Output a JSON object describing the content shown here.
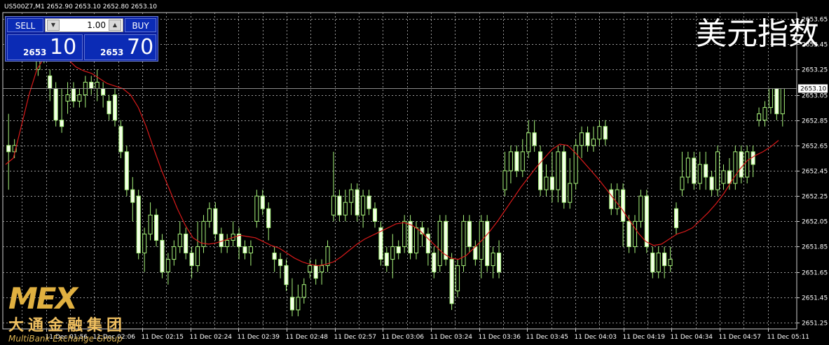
{
  "header": {
    "title": "US500Z7,M1  2652.90 2653.10 2652.80 2653.10",
    "watermark": "美元指数"
  },
  "trade_panel": {
    "sell_label": "SELL",
    "buy_label": "BUY",
    "lot": "1.00",
    "sell_small": "2653",
    "sell_big": "10",
    "buy_small": "2653",
    "buy_big": "70"
  },
  "logo": {
    "mark": "MEX",
    "cn": "大通金融集团",
    "en": "MultiBank Exchange Group"
  },
  "colors": {
    "background": "#000000",
    "grid": "#9a9a9a",
    "candle": "#a6f27a",
    "ma": "#d81a1a",
    "current_price_line": "#8a8a8a"
  },
  "chart_data": {
    "type": "line",
    "ylim": [
      2651.2,
      2653.7
    ],
    "current_price": "2653.10",
    "y_ticks": [
      "2653.65",
      "2653.45",
      "2653.25",
      "2653.05",
      "2652.85",
      "2652.65",
      "2652.45",
      "2652.25",
      "2652.05",
      "2651.85",
      "2651.65",
      "2651.45",
      "2651.25"
    ],
    "x_ticks": [
      "11 Dec 01:56",
      "11 Dec 02:06",
      "11 Dec 02:15",
      "11 Dec 02:24",
      "11 Dec 02:39",
      "11 Dec 02:48",
      "11 Dec 02:57",
      "11 Dec 03:06",
      "11 Dec 03:24",
      "11 Dec 03:36",
      "11 Dec 03:45",
      "11 Dec 04:03",
      "11 Dec 04:19",
      "11 Dec 04:34",
      "11 Dec 04:57",
      "11 Dec 05:11"
    ],
    "candles": [
      [
        2652.65,
        2652.6,
        2652.9,
        2652.3
      ],
      [
        2652.6,
        2652.65,
        2652.7,
        2652.55
      ],
      [
        2653.45,
        2653.5,
        2653.6,
        2653.35
      ],
      [
        2653.55,
        2653.5,
        2653.6,
        2653.45
      ],
      [
        2653.4,
        2653.55,
        2653.6,
        2653.35
      ],
      [
        2653.25,
        2653.4,
        2653.45,
        2653.2
      ],
      [
        2653.4,
        2653.5,
        2653.55,
        2653.3
      ],
      [
        2653.2,
        2653.1,
        2653.25,
        2653.0
      ],
      [
        2653.1,
        2652.85,
        2653.15,
        2652.8
      ],
      [
        2652.85,
        2652.8,
        2653.1,
        2652.75
      ],
      [
        2653.0,
        2653.05,
        2653.15,
        2652.9
      ],
      [
        2653.1,
        2653.0,
        2653.15,
        2652.95
      ],
      [
        2653.0,
        2653.05,
        2653.1,
        2652.95
      ],
      [
        2653.05,
        2653.15,
        2653.2,
        2652.95
      ],
      [
        2653.15,
        2653.1,
        2653.2,
        2653.05
      ],
      [
        2653.1,
        2653.15,
        2653.25,
        2653.0
      ],
      [
        2653.1,
        2653.05,
        2653.15,
        2652.95
      ],
      [
        2653.0,
        2652.9,
        2653.05,
        2652.85
      ],
      [
        2653.05,
        2652.85,
        2653.1,
        2652.8
      ],
      [
        2652.8,
        2652.6,
        2652.85,
        2652.55
      ],
      [
        2652.6,
        2652.3,
        2652.65,
        2652.25
      ],
      [
        2652.3,
        2652.2,
        2652.4,
        2652.05
      ],
      [
        2652.25,
        2651.8,
        2652.3,
        2651.75
      ],
      [
        2651.8,
        2651.95,
        2652.0,
        2651.65
      ],
      [
        2651.95,
        2652.1,
        2652.2,
        2651.9
      ],
      [
        2652.1,
        2651.9,
        2652.15,
        2651.85
      ],
      [
        2651.9,
        2651.65,
        2651.95,
        2651.6
      ],
      [
        2651.65,
        2651.75,
        2651.8,
        2651.55
      ],
      [
        2651.75,
        2651.85,
        2651.9,
        2651.7
      ],
      [
        2651.85,
        2651.95,
        2652.05,
        2651.8
      ],
      [
        2651.95,
        2651.8,
        2652.0,
        2651.75
      ],
      [
        2651.8,
        2651.7,
        2651.85,
        2651.6
      ],
      [
        2651.7,
        2651.85,
        2652.05,
        2651.65
      ],
      [
        2651.85,
        2652.05,
        2652.1,
        2651.8
      ],
      [
        2652.05,
        2652.15,
        2652.2,
        2652.0
      ],
      [
        2652.15,
        2651.95,
        2652.2,
        2651.9
      ],
      [
        2651.95,
        2651.85,
        2652.0,
        2651.8
      ],
      [
        2651.85,
        2651.9,
        2651.95,
        2651.8
      ],
      [
        2651.9,
        2651.95,
        2652.05,
        2651.85
      ],
      [
        2651.95,
        2651.85,
        2652.0,
        2651.75
      ],
      [
        2651.85,
        2651.8,
        2651.9,
        2651.75
      ],
      [
        2651.8,
        2651.85,
        2651.9,
        2651.7
      ],
      [
        2652.05,
        2652.25,
        2652.3,
        2652.0
      ],
      [
        2652.25,
        2652.15,
        2652.3,
        2652.1
      ],
      [
        2652.15,
        2652.0,
        2652.2,
        2651.9
      ],
      [
        2651.8,
        2651.75,
        2651.85,
        2651.65
      ],
      [
        2651.75,
        2651.7,
        2651.8,
        2651.6
      ],
      [
        2651.7,
        2651.55,
        2651.75,
        2651.5
      ],
      [
        2651.45,
        2651.35,
        2651.6,
        2651.3
      ],
      [
        2651.35,
        2651.45,
        2651.55,
        2651.3
      ],
      [
        2651.45,
        2651.55,
        2651.6,
        2651.4
      ],
      [
        2651.65,
        2651.7,
        2651.75,
        2651.6
      ],
      [
        2651.7,
        2651.6,
        2651.75,
        2651.55
      ],
      [
        2651.65,
        2651.7,
        2651.75,
        2651.55
      ],
      [
        2651.7,
        2651.85,
        2651.9,
        2651.65
      ],
      [
        2652.1,
        2652.25,
        2652.6,
        2652.05
      ],
      [
        2652.25,
        2652.1,
        2652.3,
        2652.05
      ],
      [
        2652.1,
        2652.2,
        2652.3,
        2652.05
      ],
      [
        2652.2,
        2652.3,
        2652.35,
        2652.1
      ],
      [
        2652.3,
        2652.1,
        2652.35,
        2652.05
      ],
      [
        2652.1,
        2652.25,
        2652.3,
        2652.0
      ],
      [
        2652.25,
        2652.15,
        2652.3,
        2652.1
      ],
      [
        2652.15,
        2652.05,
        2652.2,
        2652.0
      ],
      [
        2652.0,
        2651.75,
        2652.05,
        2651.7
      ],
      [
        2651.8,
        2651.7,
        2651.85,
        2651.65
      ],
      [
        2651.75,
        2651.85,
        2651.95,
        2651.6
      ],
      [
        2651.85,
        2651.8,
        2651.9,
        2651.75
      ],
      [
        2651.85,
        2652.05,
        2652.1,
        2651.8
      ],
      [
        2652.05,
        2651.8,
        2652.1,
        2651.75
      ],
      [
        2651.8,
        2652.0,
        2652.05,
        2651.75
      ],
      [
        2652.0,
        2651.95,
        2652.05,
        2651.85
      ],
      [
        2651.95,
        2651.8,
        2652.0,
        2651.7
      ],
      [
        2651.8,
        2651.65,
        2651.85,
        2651.6
      ],
      [
        2651.7,
        2652.05,
        2652.1,
        2651.65
      ],
      [
        2652.05,
        2651.75,
        2652.1,
        2651.7
      ],
      [
        2651.75,
        2651.4,
        2651.8,
        2651.35
      ],
      [
        2651.5,
        2651.7,
        2651.75,
        2651.45
      ],
      [
        2651.7,
        2652.05,
        2652.1,
        2651.65
      ],
      [
        2652.05,
        2651.85,
        2652.1,
        2651.8
      ],
      [
        2651.85,
        2651.75,
        2651.9,
        2651.7
      ],
      [
        2651.75,
        2652.05,
        2652.1,
        2651.6
      ],
      [
        2652.05,
        2651.7,
        2652.1,
        2651.65
      ],
      [
        2651.7,
        2651.8,
        2651.85,
        2651.6
      ],
      [
        2651.8,
        2651.65,
        2651.9,
        2651.6
      ],
      [
        2652.3,
        2652.45,
        2652.6,
        2652.25
      ],
      [
        2652.45,
        2652.6,
        2652.65,
        2652.35
      ],
      [
        2652.6,
        2652.45,
        2652.65,
        2652.4
      ],
      [
        2652.45,
        2652.6,
        2652.7,
        2652.4
      ],
      [
        2652.6,
        2652.75,
        2652.85,
        2652.55
      ],
      [
        2652.75,
        2652.65,
        2652.85,
        2652.6
      ],
      [
        2652.6,
        2652.3,
        2652.65,
        2652.25
      ],
      [
        2652.3,
        2652.4,
        2652.5,
        2652.25
      ],
      [
        2652.4,
        2652.3,
        2652.6,
        2652.2
      ],
      [
        2652.3,
        2652.6,
        2652.65,
        2652.2
      ],
      [
        2652.6,
        2652.2,
        2652.65,
        2652.15
      ],
      [
        2652.2,
        2652.35,
        2652.55,
        2652.15
      ],
      [
        2652.35,
        2652.65,
        2652.7,
        2652.3
      ],
      [
        2652.65,
        2652.75,
        2652.8,
        2652.55
      ],
      [
        2652.75,
        2652.65,
        2652.8,
        2652.6
      ],
      [
        2652.65,
        2652.7,
        2652.8,
        2652.6
      ],
      [
        2652.7,
        2652.8,
        2652.85,
        2652.65
      ],
      [
        2652.8,
        2652.7,
        2652.85,
        2652.65
      ],
      [
        2652.3,
        2652.15,
        2652.35,
        2652.1
      ],
      [
        2652.15,
        2652.3,
        2652.35,
        2652.1
      ],
      [
        2652.3,
        2652.05,
        2652.35,
        2651.85
      ],
      [
        2652.05,
        2651.85,
        2652.1,
        2651.8
      ],
      [
        2651.85,
        2652.05,
        2652.1,
        2651.8
      ],
      [
        2652.05,
        2652.25,
        2652.3,
        2652.0
      ],
      [
        2652.25,
        2651.85,
        2652.3,
        2651.8
      ],
      [
        2651.8,
        2651.65,
        2651.85,
        2651.6
      ],
      [
        2651.65,
        2651.8,
        2651.85,
        2651.6
      ],
      [
        2651.8,
        2651.7,
        2651.85,
        2651.6
      ],
      [
        2651.7,
        2651.75,
        2651.85,
        2651.65
      ],
      [
        2652.15,
        2652.0,
        2652.2,
        2651.95
      ],
      [
        2652.3,
        2652.4,
        2652.6,
        2652.25
      ],
      [
        2652.4,
        2652.55,
        2652.6,
        2652.35
      ],
      [
        2652.55,
        2652.35,
        2652.6,
        2652.3
      ],
      [
        2652.35,
        2652.5,
        2652.6,
        2652.3
      ],
      [
        2652.5,
        2652.4,
        2652.6,
        2652.3
      ],
      [
        2652.4,
        2652.3,
        2652.45,
        2652.25
      ],
      [
        2652.3,
        2652.6,
        2652.65,
        2652.25
      ],
      [
        2652.35,
        2652.45,
        2652.5,
        2652.3
      ],
      [
        2652.45,
        2652.35,
        2652.55,
        2652.3
      ],
      [
        2652.35,
        2652.6,
        2652.65,
        2652.3
      ],
      [
        2652.6,
        2652.4,
        2652.65,
        2652.35
      ],
      [
        2652.4,
        2652.6,
        2652.65,
        2652.35
      ],
      [
        2652.6,
        2652.5,
        2652.65,
        2652.4
      ],
      [
        2652.85,
        2652.9,
        2652.95,
        2652.8
      ],
      [
        2652.85,
        2652.95,
        2653.0,
        2652.8
      ],
      [
        2652.95,
        2653.1,
        2653.1,
        2652.9
      ],
      [
        2653.1,
        2652.9,
        2653.1,
        2652.85
      ],
      [
        2652.9,
        2653.1,
        2653.1,
        2652.8
      ]
    ],
    "ma": [
      2652.5,
      2652.55,
      2652.8,
      2653.05,
      2653.25,
      2653.35,
      2653.4,
      2653.38,
      2653.33,
      2653.27,
      2653.24,
      2653.22,
      2653.18,
      2653.14,
      2653.12,
      2653.1,
      2653.05,
      2652.95,
      2652.8,
      2652.62,
      2652.45,
      2652.3,
      2652.15,
      2652.02,
      2651.92,
      2651.88,
      2651.87,
      2651.88,
      2651.9,
      2651.92,
      2651.94,
      2651.93,
      2651.92,
      2651.89,
      2651.86,
      2651.84,
      2651.8,
      2651.76,
      2651.73,
      2651.71,
      2651.7,
      2651.71,
      2651.73,
      2651.77,
      2651.82,
      2651.87,
      2651.91,
      2651.94,
      2651.97,
      2652.0,
      2652.03,
      2652.04,
      2652.02,
      2651.98,
      2651.92,
      2651.86,
      2651.8,
      2651.76,
      2651.75,
      2651.78,
      2651.84,
      2651.9,
      2651.97,
      2652.05,
      2652.14,
      2652.23,
      2652.32,
      2652.4,
      2652.48,
      2652.55,
      2652.62,
      2652.66,
      2652.65,
      2652.59,
      2652.52,
      2652.45,
      2652.38,
      2652.3,
      2652.22,
      2652.14,
      2652.05,
      2651.96,
      2651.89,
      2651.86,
      2651.87,
      2651.91,
      2651.95,
      2651.97,
      2652.0,
      2652.06,
      2652.12,
      2652.19,
      2652.27,
      2652.37,
      2652.46,
      2652.53,
      2652.57,
      2652.6,
      2652.64,
      2652.69
    ]
  }
}
